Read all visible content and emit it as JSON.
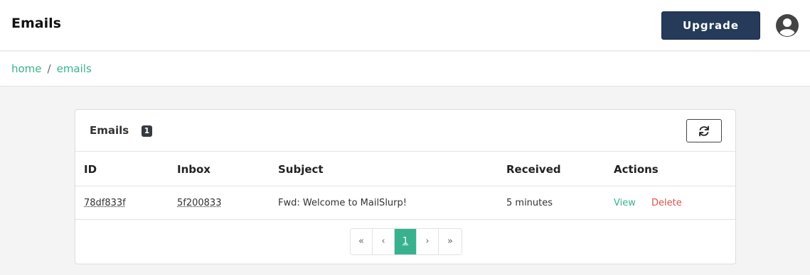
{
  "header": {
    "title": "Emails",
    "upgrade_label": "Upgrade",
    "avatar_icon": "user-circle-icon"
  },
  "breadcrumb": {
    "items": [
      "home",
      "emails"
    ],
    "separator": "/"
  },
  "card": {
    "title": "Emails",
    "count": "1",
    "refresh_icon": "refresh-icon"
  },
  "table": {
    "headers": [
      "ID",
      "Inbox",
      "Subject",
      "Received",
      "Actions"
    ],
    "rows": [
      {
        "id": "78df833f",
        "inbox": "5f200833",
        "subject": "Fwd: Welcome to MailSlurp!",
        "received": "5 minutes",
        "view_label": "View",
        "delete_label": "Delete"
      }
    ]
  },
  "pagination": {
    "first": "«",
    "prev": "‹",
    "current": "1",
    "next": "›",
    "last": "»"
  },
  "colors": {
    "accent": "#38b28e",
    "upgrade_bg": "#263a5a",
    "danger": "#d9534f"
  }
}
